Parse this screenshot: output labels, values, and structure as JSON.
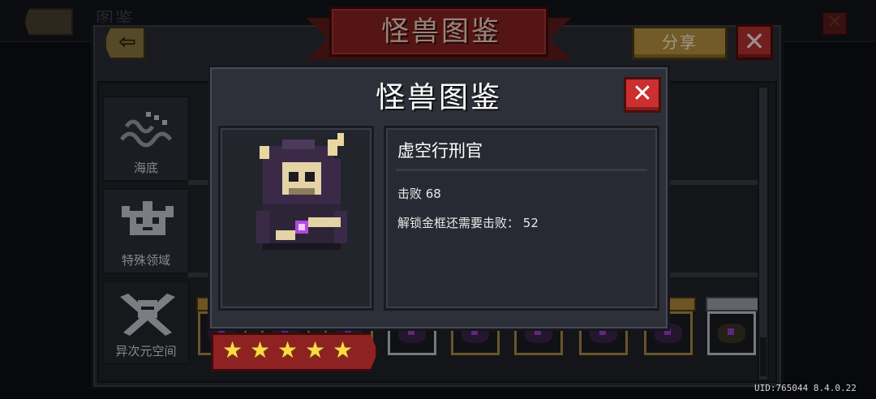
{
  "background": {
    "title": "图鉴"
  },
  "header": {
    "banner_title": "怪兽图鉴",
    "share_label": "分享"
  },
  "categories": [
    {
      "label": "海底",
      "icon": "waves-icon"
    },
    {
      "label": "特殊领域",
      "icon": "ornate-mask-icon"
    },
    {
      "label": "异次元空间",
      "icon": "crossed-swords-helmet-icon"
    }
  ],
  "modal": {
    "title": "怪兽图鉴",
    "monster_name": "虚空行刑官",
    "defeat_text": "击败 68",
    "unlock_text": "解锁金框还需要击败： 52",
    "stars": 5,
    "star_glyph": "★"
  },
  "footer": {
    "uid": "UID:765044 8.4.0.22"
  },
  "colors": {
    "gold_frame": "#a88944",
    "ribbon_red": "#8e2121",
    "close_red": "#cc2f2f",
    "star_yellow": "#ffd84a"
  }
}
